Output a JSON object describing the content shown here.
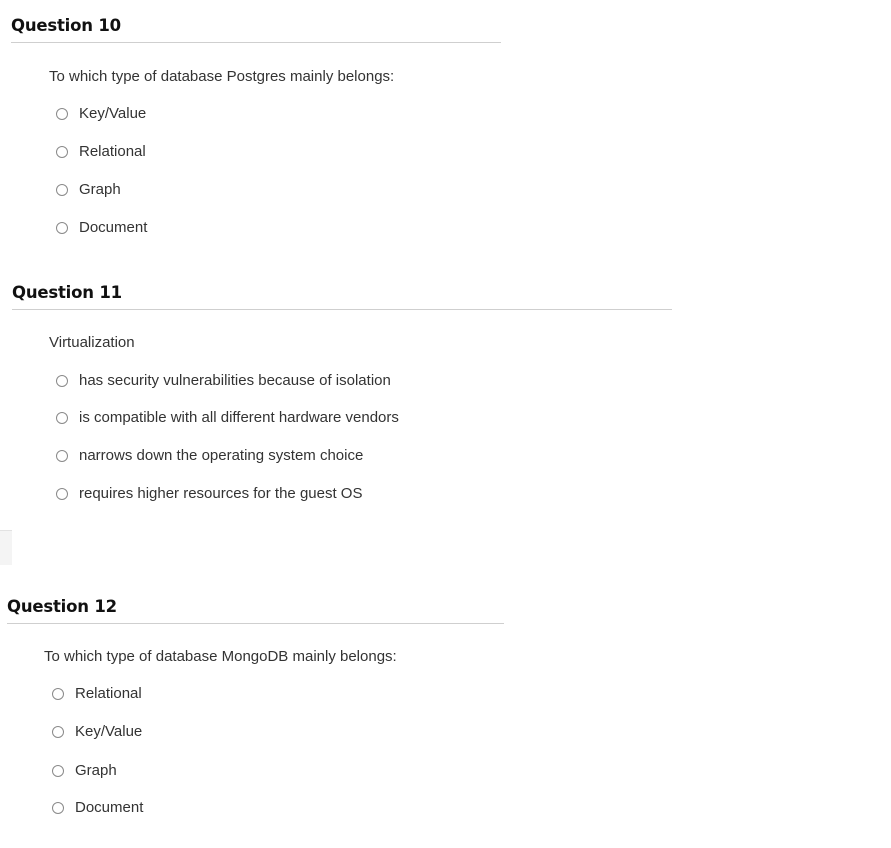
{
  "questions": [
    {
      "title": "Question 10",
      "prompt": "To which type of database Postgres mainly belongs:",
      "options": [
        "Key/Value",
        "Relational",
        "Graph",
        "Document"
      ]
    },
    {
      "title": "Question 11",
      "prompt": "Virtualization",
      "options": [
        "has security vulnerabilities because of isolation",
        "is compatible with all different hardware vendors",
        "narrows down the operating system choice",
        "requires higher resources for the guest OS"
      ]
    },
    {
      "title": "Question 12",
      "prompt": "To which type of database MongoDB mainly belongs:",
      "options": [
        "Relational",
        "Key/Value",
        "Graph",
        "Document"
      ]
    }
  ],
  "colors": {
    "header_text": "#111111",
    "body_text": "#333333",
    "divider": "#cfcfcf",
    "radio_border": "#8a8a8a"
  }
}
